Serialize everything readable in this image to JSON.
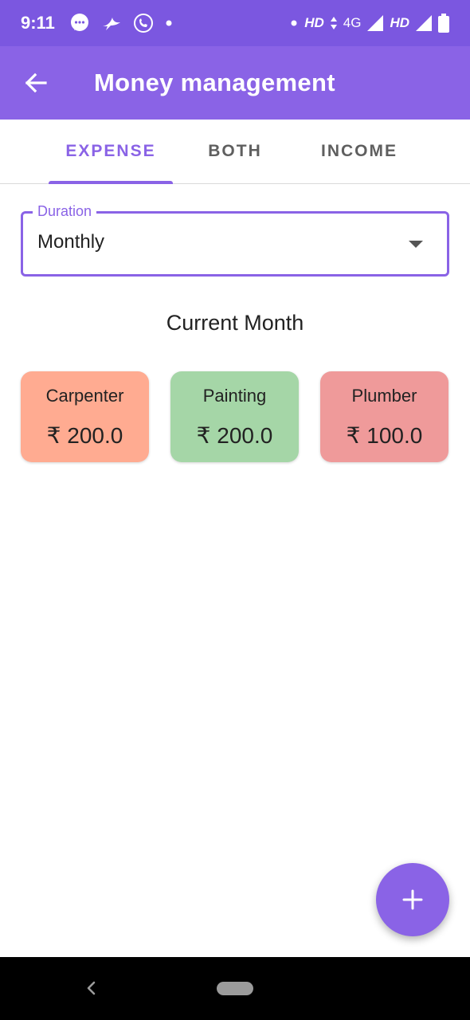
{
  "status_bar": {
    "time": "9:11",
    "icons_left": [
      "chat-bubble-icon",
      "bird-icon",
      "call-icon",
      "dot-icon"
    ],
    "right_labels": [
      "HD",
      "4G",
      "HD"
    ],
    "icons_right": [
      "dot-icon",
      "data-arrows-icon",
      "signal-icon",
      "signal-icon",
      "battery-icon"
    ]
  },
  "app_bar": {
    "title": "Money management",
    "back_icon": "arrow-left-icon"
  },
  "tabs": [
    {
      "label": "EXPENSE",
      "active": true
    },
    {
      "label": "BOTH",
      "active": false
    },
    {
      "label": "INCOME",
      "active": false
    }
  ],
  "duration": {
    "label": "Duration",
    "value": "Monthly"
  },
  "section_title": "Current Month",
  "cards": [
    {
      "label": "Carpenter",
      "amount": "₹ 200.0",
      "color": "#ffab91"
    },
    {
      "label": "Painting",
      "amount": "₹ 200.0",
      "color": "#a5d6a7"
    },
    {
      "label": "Plumber",
      "amount": "₹ 100.0",
      "color": "#ef9a9a"
    }
  ],
  "fab": {
    "icon": "plus-icon"
  },
  "colors": {
    "status_bar": "#7b57e0",
    "primary": "#8a63e6",
    "nav_bar": "#000000"
  }
}
